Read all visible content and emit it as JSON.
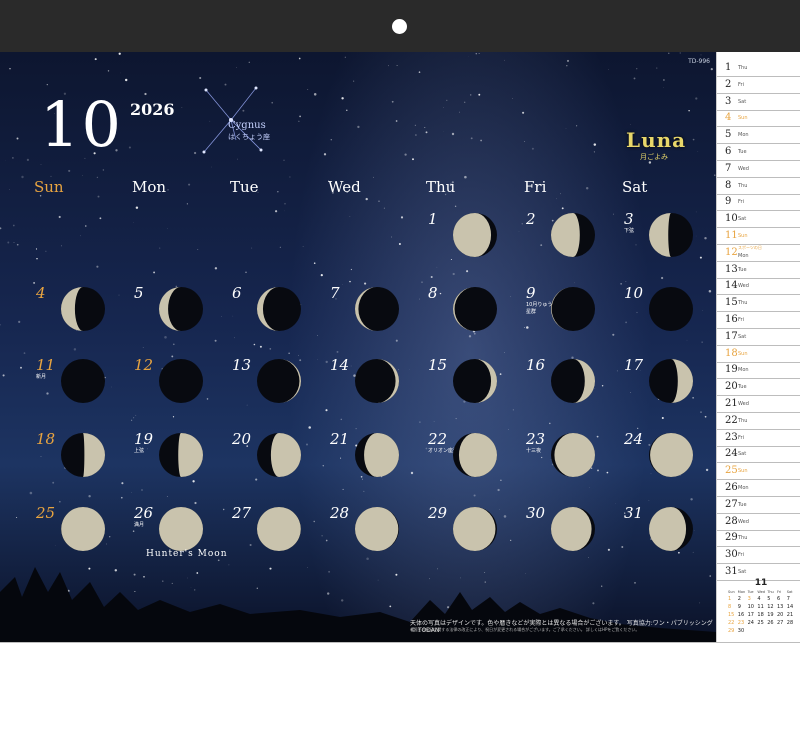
{
  "calendar": {
    "month": "10",
    "year": "2026",
    "code": "TD-996",
    "logo": "Luna",
    "logo_sub": "月ごよみ",
    "constellation": {
      "name": "Cygnus",
      "jp": "はくちょう座"
    },
    "hunters_moon": "Hunter's Moon",
    "weekdays": [
      "Sun",
      "Mon",
      "Tue",
      "Wed",
      "Thu",
      "Fri",
      "Sat"
    ],
    "days": [
      {
        "n": "1",
        "phase": 0.62,
        "note": ""
      },
      {
        "n": "2",
        "phase": 0.7,
        "note": ""
      },
      {
        "n": "3",
        "phase": 0.77,
        "note": "下弦"
      },
      {
        "n": "4",
        "phase": 0.81,
        "note": ""
      },
      {
        "n": "5",
        "phase": 0.85,
        "note": ""
      },
      {
        "n": "6",
        "phase": 0.88,
        "note": ""
      },
      {
        "n": "7",
        "phase": 0.91,
        "note": ""
      },
      {
        "n": "8",
        "phase": 0.94,
        "note": ""
      },
      {
        "n": "9",
        "phase": 0.96,
        "note": "10月りゅう座流星群"
      },
      {
        "n": "10",
        "phase": 0.98,
        "note": ""
      },
      {
        "n": "11",
        "phase": 0.0,
        "note": "新月"
      },
      {
        "n": "12",
        "phase": 0.03,
        "note": ""
      },
      {
        "n": "13",
        "phase": 0.06,
        "note": ""
      },
      {
        "n": "14",
        "phase": 0.09,
        "note": ""
      },
      {
        "n": "15",
        "phase": 0.12,
        "note": ""
      },
      {
        "n": "16",
        "phase": 0.16,
        "note": ""
      },
      {
        "n": "17",
        "phase": 0.2,
        "note": ""
      },
      {
        "n": "18",
        "phase": 0.24,
        "note": ""
      },
      {
        "n": "19",
        "phase": 0.27,
        "note": "上弦"
      },
      {
        "n": "20",
        "phase": 0.31,
        "note": ""
      },
      {
        "n": "21",
        "phase": 0.35,
        "note": ""
      },
      {
        "n": "22",
        "phase": 0.38,
        "note": "オリオン座流星群"
      },
      {
        "n": "23",
        "phase": 0.41,
        "note": "十三夜"
      },
      {
        "n": "24",
        "phase": 0.45,
        "note": ""
      },
      {
        "n": "25",
        "phase": 0.48,
        "note": ""
      },
      {
        "n": "26",
        "phase": 0.5,
        "note": "満月"
      },
      {
        "n": "27",
        "phase": 0.52,
        "note": ""
      },
      {
        "n": "28",
        "phase": 0.54,
        "note": ""
      },
      {
        "n": "29",
        "phase": 0.56,
        "note": ""
      },
      {
        "n": "30",
        "phase": 0.59,
        "note": ""
      },
      {
        "n": "31",
        "phase": 0.63,
        "note": ""
      }
    ],
    "caption": "天体の写真はデザインです。色や暦きなどが実際とは異なる場合がございます。 写真協力:ワン・パブリッシング © TODAN",
    "caption_small": "※国民の祝日に関する法律の改正により、祝日が変更される場合がございます。ご了承ください。 詳しくはHPをご覧ください。"
  },
  "side_list": [
    {
      "n": "1",
      "wd": "Thu",
      "note": ""
    },
    {
      "n": "2",
      "wd": "Fri",
      "note": ""
    },
    {
      "n": "3",
      "wd": "Sat",
      "note": ""
    },
    {
      "n": "4",
      "wd": "Sun",
      "note": ""
    },
    {
      "n": "5",
      "wd": "Mon",
      "note": ""
    },
    {
      "n": "6",
      "wd": "Tue",
      "note": ""
    },
    {
      "n": "7",
      "wd": "Wed",
      "note": ""
    },
    {
      "n": "8",
      "wd": "Thu",
      "note": ""
    },
    {
      "n": "9",
      "wd": "Fri",
      "note": ""
    },
    {
      "n": "10",
      "wd": "Sat",
      "note": ""
    },
    {
      "n": "11",
      "wd": "Sun",
      "note": ""
    },
    {
      "n": "12",
      "wd": "Mon",
      "note": "スポーツの日"
    },
    {
      "n": "13",
      "wd": "Tue",
      "note": ""
    },
    {
      "n": "14",
      "wd": "Wed",
      "note": ""
    },
    {
      "n": "15",
      "wd": "Thu",
      "note": ""
    },
    {
      "n": "16",
      "wd": "Fri",
      "note": ""
    },
    {
      "n": "17",
      "wd": "Sat",
      "note": ""
    },
    {
      "n": "18",
      "wd": "Sun",
      "note": ""
    },
    {
      "n": "19",
      "wd": "Mon",
      "note": ""
    },
    {
      "n": "20",
      "wd": "Tue",
      "note": ""
    },
    {
      "n": "21",
      "wd": "Wed",
      "note": ""
    },
    {
      "n": "22",
      "wd": "Thu",
      "note": ""
    },
    {
      "n": "23",
      "wd": "Fri",
      "note": ""
    },
    {
      "n": "24",
      "wd": "Sat",
      "note": ""
    },
    {
      "n": "25",
      "wd": "Sun",
      "note": ""
    },
    {
      "n": "26",
      "wd": "Mon",
      "note": ""
    },
    {
      "n": "27",
      "wd": "Tue",
      "note": ""
    },
    {
      "n": "28",
      "wd": "Wed",
      "note": ""
    },
    {
      "n": "29",
      "wd": "Thu",
      "note": ""
    },
    {
      "n": "30",
      "wd": "Fri",
      "note": ""
    },
    {
      "n": "31",
      "wd": "Sat",
      "note": ""
    }
  ],
  "mini_calendar": {
    "month": "11",
    "headers": [
      "Sun",
      "Mon",
      "Tue",
      "Wed",
      "Thu",
      "Fri",
      "Sat"
    ],
    "days": [
      "1",
      "2",
      "3",
      "4",
      "5",
      "6",
      "7",
      "8",
      "9",
      "10",
      "11",
      "12",
      "13",
      "14",
      "15",
      "16",
      "17",
      "18",
      "19",
      "20",
      "21",
      "22",
      "23",
      "24",
      "25",
      "26",
      "27",
      "28",
      "29",
      "30"
    ]
  },
  "colors": {
    "sunday": "#e8a440",
    "logo": "#e8d76a"
  }
}
